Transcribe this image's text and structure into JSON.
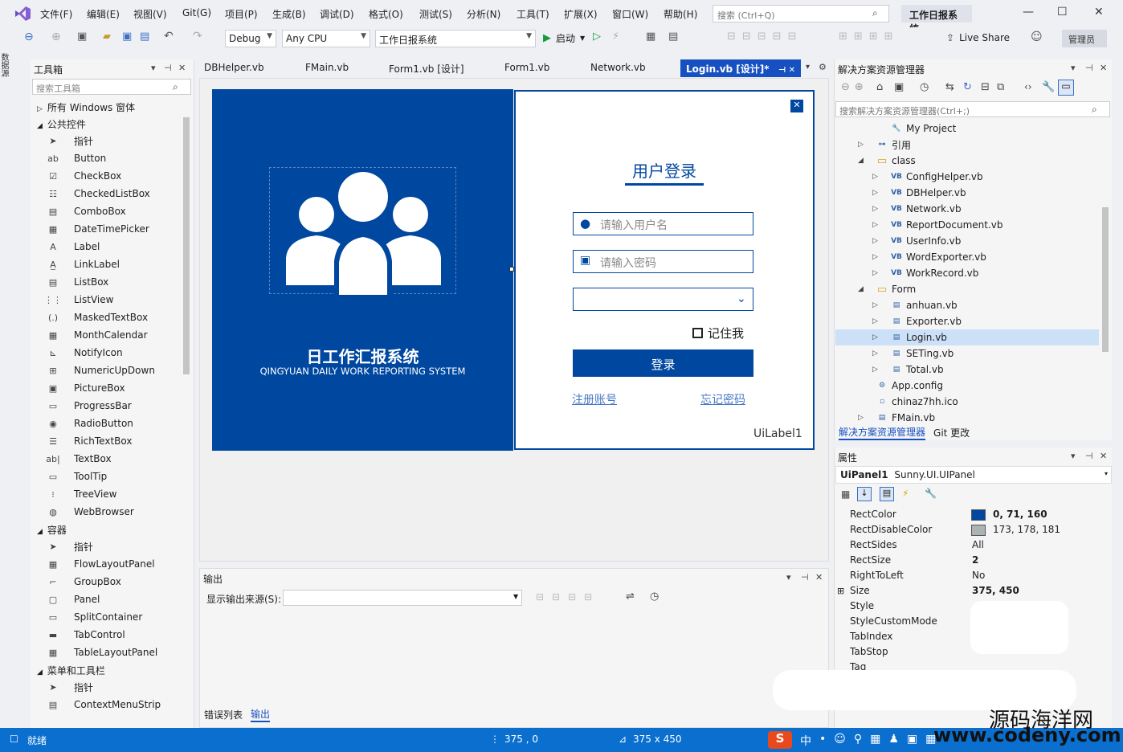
{
  "menu": {
    "items": [
      "文件(F)",
      "编辑(E)",
      "视图(V)",
      "Git(G)",
      "项目(P)",
      "生成(B)",
      "调试(D)",
      "格式(O)",
      "测试(S)",
      "分析(N)",
      "工具(T)",
      "扩展(X)",
      "窗口(W)",
      "帮助(H)"
    ],
    "search_placeholder": "搜索 (Ctrl+Q)",
    "project_name": "工作日报系统"
  },
  "toolbar": {
    "config": "Debug",
    "platform": "Any CPU",
    "startup_project": "工作日报系统",
    "start_label": "启动",
    "live_share": "Live Share",
    "admin": "管理员"
  },
  "left_strip": {
    "label": "数据源"
  },
  "toolbox": {
    "title": "工具箱",
    "search_placeholder": "搜索工具箱",
    "group_all_windows": "所有 Windows 窗体",
    "group_common": "公共控件",
    "common_items": [
      {
        "label": "指针",
        "icon": "pointer-icon",
        "glyph": "➤"
      },
      {
        "label": "Button",
        "icon": "button-icon",
        "glyph": "ab"
      },
      {
        "label": "CheckBox",
        "icon": "checkbox-icon",
        "glyph": "☑"
      },
      {
        "label": "CheckedListBox",
        "icon": "checkedlistbox-icon",
        "glyph": "☷"
      },
      {
        "label": "ComboBox",
        "icon": "combobox-icon",
        "glyph": "▤"
      },
      {
        "label": "DateTimePicker",
        "icon": "datetimepicker-icon",
        "glyph": "▦"
      },
      {
        "label": "Label",
        "icon": "label-icon",
        "glyph": "A"
      },
      {
        "label": "LinkLabel",
        "icon": "linklabel-icon",
        "glyph": "A̲"
      },
      {
        "label": "ListBox",
        "icon": "listbox-icon",
        "glyph": "▤"
      },
      {
        "label": "ListView",
        "icon": "listview-icon",
        "glyph": "⋮⋮"
      },
      {
        "label": "MaskedTextBox",
        "icon": "maskedtextbox-icon",
        "glyph": "(.)"
      },
      {
        "label": "MonthCalendar",
        "icon": "monthcalendar-icon",
        "glyph": "▦"
      },
      {
        "label": "NotifyIcon",
        "icon": "notifyicon-icon",
        "glyph": "⊾"
      },
      {
        "label": "NumericUpDown",
        "icon": "numericupdown-icon",
        "glyph": "⊞"
      },
      {
        "label": "PictureBox",
        "icon": "picturebox-icon",
        "glyph": "▣"
      },
      {
        "label": "ProgressBar",
        "icon": "progressbar-icon",
        "glyph": "▭"
      },
      {
        "label": "RadioButton",
        "icon": "radiobutton-icon",
        "glyph": "◉"
      },
      {
        "label": "RichTextBox",
        "icon": "richtextbox-icon",
        "glyph": "☰"
      },
      {
        "label": "TextBox",
        "icon": "textbox-icon",
        "glyph": "ab|"
      },
      {
        "label": "ToolTip",
        "icon": "tooltip-icon",
        "glyph": "▭"
      },
      {
        "label": "TreeView",
        "icon": "treeview-icon",
        "glyph": "⁝"
      },
      {
        "label": "WebBrowser",
        "icon": "webbrowser-icon",
        "glyph": "◍"
      }
    ],
    "group_containers": "容器",
    "container_items": [
      {
        "label": "指针",
        "icon": "pointer-icon",
        "glyph": "➤"
      },
      {
        "label": "FlowLayoutPanel",
        "icon": "flowlayoutpanel-icon",
        "glyph": "▦"
      },
      {
        "label": "GroupBox",
        "icon": "groupbox-icon",
        "glyph": "⌐"
      },
      {
        "label": "Panel",
        "icon": "panel-icon",
        "glyph": "▢"
      },
      {
        "label": "SplitContainer",
        "icon": "splitcontainer-icon",
        "glyph": "▭"
      },
      {
        "label": "TabControl",
        "icon": "tabcontrol-icon",
        "glyph": "▬"
      },
      {
        "label": "TableLayoutPanel",
        "icon": "tablelayoutpanel-icon",
        "glyph": "▦"
      }
    ],
    "group_menus": "菜单和工具栏",
    "menu_items": [
      {
        "label": "指针",
        "icon": "pointer-icon",
        "glyph": "➤"
      },
      {
        "label": "ContextMenuStrip",
        "icon": "contextmenustrip-icon",
        "glyph": "▤"
      }
    ]
  },
  "tabs": [
    {
      "label": "DBHelper.vb",
      "active": false
    },
    {
      "label": "FMain.vb",
      "active": false
    },
    {
      "label": "Form1.vb [设计]",
      "active": false
    },
    {
      "label": "Form1.vb",
      "active": false
    },
    {
      "label": "Network.vb",
      "active": false
    },
    {
      "label": "Login.vb [设计]*",
      "active": true
    }
  ],
  "login_form": {
    "title": "用户登录",
    "username_placeholder": "请输入用户名",
    "password_placeholder": "请输入密码",
    "remember_me": "记住我",
    "login_button": "登录",
    "register_link": "注册账号",
    "forgot_link": "忘记密码",
    "label": "UiLabel1",
    "system_title": "日工作汇报系统",
    "system_subtitle": "QINGYUAN DAILY WORK REPORTING SYSTEM",
    "brand_color": "#0047a0"
  },
  "output": {
    "title": "输出",
    "source_label": "显示输出来源(S):",
    "tab_errors": "错误列表",
    "tab_output": "输出"
  },
  "solution_explorer": {
    "title": "解决方案资源管理器",
    "search_placeholder": "搜索解决方案资源管理器(Ctrl+;)",
    "items": [
      {
        "label": "My Project",
        "level": 1,
        "expander": "",
        "icon": "wrench-icon",
        "glyph": "🔧"
      },
      {
        "label": "引用",
        "level": 0,
        "expander": "▷",
        "icon": "references-icon",
        "glyph": "⊶"
      },
      {
        "label": "class",
        "level": 0,
        "expander": "◢",
        "icon": "folder-icon",
        "glyph": "▭"
      },
      {
        "label": "ConfigHelper.vb",
        "level": 1,
        "expander": "▷",
        "icon": "vb-file-icon",
        "glyph": "VB"
      },
      {
        "label": "DBHelper.vb",
        "level": 1,
        "expander": "▷",
        "icon": "vb-file-icon",
        "glyph": "VB"
      },
      {
        "label": "Network.vb",
        "level": 1,
        "expander": "▷",
        "icon": "vb-file-icon",
        "glyph": "VB"
      },
      {
        "label": "ReportDocument.vb",
        "level": 1,
        "expander": "▷",
        "icon": "vb-file-icon",
        "glyph": "VB"
      },
      {
        "label": "UserInfo.vb",
        "level": 1,
        "expander": "▷",
        "icon": "vb-file-icon",
        "glyph": "VB"
      },
      {
        "label": "WordExporter.vb",
        "level": 1,
        "expander": "▷",
        "icon": "vb-file-icon",
        "glyph": "VB"
      },
      {
        "label": "WorkRecord.vb",
        "level": 1,
        "expander": "▷",
        "icon": "vb-file-icon",
        "glyph": "VB"
      },
      {
        "label": "Form",
        "level": 0,
        "expander": "◢",
        "icon": "folder-icon",
        "glyph": "▭"
      },
      {
        "label": "anhuan.vb",
        "level": 1,
        "expander": "▷",
        "icon": "form-file-icon",
        "glyph": "▤"
      },
      {
        "label": "Exporter.vb",
        "level": 1,
        "expander": "▷",
        "icon": "form-file-icon",
        "glyph": "▤"
      },
      {
        "label": "Login.vb",
        "level": 1,
        "expander": "▷",
        "icon": "form-file-icon",
        "glyph": "▤"
      },
      {
        "label": "SETing.vb",
        "level": 1,
        "expander": "▷",
        "icon": "form-file-icon",
        "glyph": "▤"
      },
      {
        "label": "Total.vb",
        "level": 1,
        "expander": "▷",
        "icon": "form-file-icon",
        "glyph": "▤"
      },
      {
        "label": "App.config",
        "level": 0,
        "expander": "",
        "icon": "config-file-icon",
        "glyph": "⚙"
      },
      {
        "label": "chinaz7hh.ico",
        "level": 0,
        "expander": "",
        "icon": "ico-file-icon",
        "glyph": "▫"
      },
      {
        "label": "FMain.vb",
        "level": 0,
        "expander": "▷",
        "icon": "form-file-icon",
        "glyph": "▤"
      }
    ],
    "selected": "Login.vb",
    "tab_solution": "解决方案资源管理器",
    "tab_git": "Git 更改"
  },
  "properties": {
    "title": "属性",
    "object_name": "UiPanel1",
    "object_type": "Sunny.UI.UIPanel",
    "rows": [
      {
        "name": "RectColor",
        "value": "0, 71, 160",
        "bold": true,
        "swatch": "#0047a0"
      },
      {
        "name": "RectDisableColor",
        "value": "173, 178, 181",
        "bold": false,
        "swatch": "#adb2b5"
      },
      {
        "name": "RectSides",
        "value": "All",
        "bold": false,
        "swatch": ""
      },
      {
        "name": "RectSize",
        "value": "2",
        "bold": true,
        "swatch": ""
      },
      {
        "name": "RightToLeft",
        "value": "No",
        "bold": false,
        "swatch": ""
      },
      {
        "name": "Size",
        "value": "375, 450",
        "bold": true,
        "swatch": ""
      },
      {
        "name": "Style",
        "value": "",
        "bold": false,
        "swatch": ""
      },
      {
        "name": "StyleCustomMode",
        "value": "",
        "bold": false,
        "swatch": ""
      },
      {
        "name": "TabIndex",
        "value": "",
        "bold": false,
        "swatch": ""
      },
      {
        "name": "TabStop",
        "value": "",
        "bold": false,
        "swatch": ""
      },
      {
        "name": "Tag",
        "value": "",
        "bold": false,
        "swatch": ""
      }
    ]
  },
  "statusbar": {
    "status": "就绪",
    "position": "375 , 0",
    "size": "375 x 450",
    "ime": "中"
  },
  "watermark": {
    "line1": "源码海洋网",
    "line2": "www.codeny.com"
  }
}
